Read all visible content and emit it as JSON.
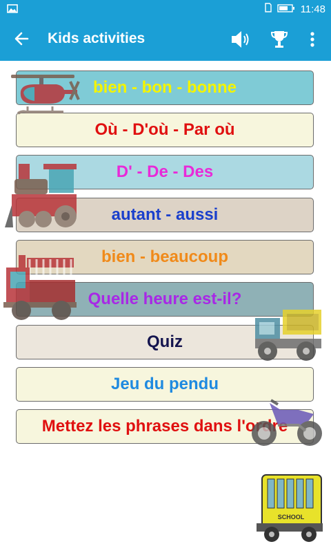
{
  "status_bar": {
    "time": "11:48",
    "icons": [
      "image-icon",
      "sim-icon",
      "battery-icon"
    ]
  },
  "app_bar": {
    "title": "Kids activities",
    "icons": [
      "back-arrow-icon",
      "speaker-icon",
      "trophy-icon",
      "more-vert-icon"
    ]
  },
  "menu": [
    {
      "label": "bien - bon - bonne",
      "color": "#f4f400",
      "bg": "#7fcbd6"
    },
    {
      "label": "Où - D'où - Par où",
      "color": "#e01010",
      "bg": "#f7f6dd"
    },
    {
      "label": "D' - De - Des",
      "color": "#e82ad8",
      "bg": "#abd9e2"
    },
    {
      "label": "autant - aussi",
      "color": "#1a3fcc",
      "bg": "#ddd3c6"
    },
    {
      "label": "bien - beaucoup",
      "color": "#f08a1a",
      "bg": "#e3d8c0"
    },
    {
      "label": "Quelle heure est-il?",
      "color": "#a828e6",
      "bg": "#8fb1b6"
    },
    {
      "label": "Quiz",
      "color": "#15154f",
      "bg": "#ece6dc"
    },
    {
      "label": "Jeu du pendu",
      "color": "#1f8ae0",
      "bg": "#f7f6dd"
    },
    {
      "label": "Mettez les phrases dans l'ordre",
      "color": "#e01010",
      "bg": "#f7f6dd"
    }
  ],
  "vehicles": [
    "helicopter",
    "train",
    "fire-truck",
    "dump-truck",
    "motorcycle",
    "school-bus"
  ],
  "bus_text": "SCHOOL"
}
